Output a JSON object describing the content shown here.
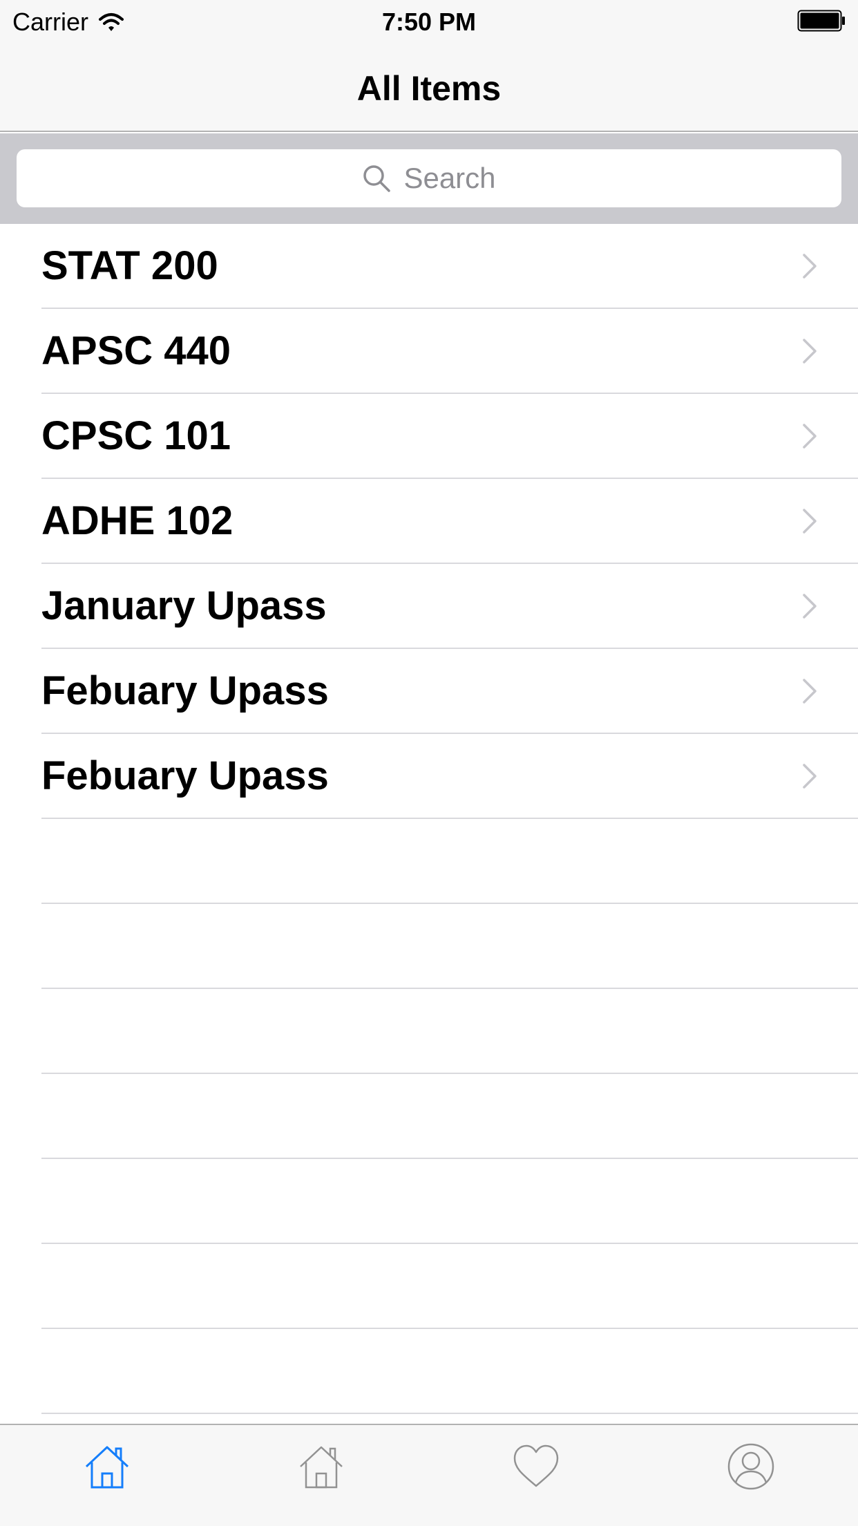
{
  "status_bar": {
    "carrier": "Carrier",
    "time": "7:50 PM",
    "wifi_icon": "wifi-icon",
    "battery_icon": "battery-icon"
  },
  "nav": {
    "title": "All Items"
  },
  "search": {
    "placeholder": "Search",
    "icon": "search-icon"
  },
  "list": {
    "items": [
      {
        "label": "STAT 200"
      },
      {
        "label": "APSC 440"
      },
      {
        "label": "CPSC 101"
      },
      {
        "label": "ADHE 102"
      },
      {
        "label": "January Upass"
      },
      {
        "label": "Febuary Upass"
      },
      {
        "label": "Febuary Upass"
      }
    ],
    "chevron_icon": "chevron-right-icon"
  },
  "tab_bar": {
    "tabs": [
      {
        "icon": "home-icon",
        "selected": true
      },
      {
        "icon": "home-outline-icon",
        "selected": false
      },
      {
        "icon": "heart-icon",
        "selected": false
      },
      {
        "icon": "profile-icon",
        "selected": false
      }
    ]
  },
  "colors": {
    "accent": "#147efb",
    "inactive_icon": "#929292",
    "separator": "#d9d9dd",
    "search_bg": "#c9c9ce",
    "bar_bg": "#f7f7f7",
    "placeholder": "#8e8e93",
    "chevron": "#c7c7cc"
  }
}
